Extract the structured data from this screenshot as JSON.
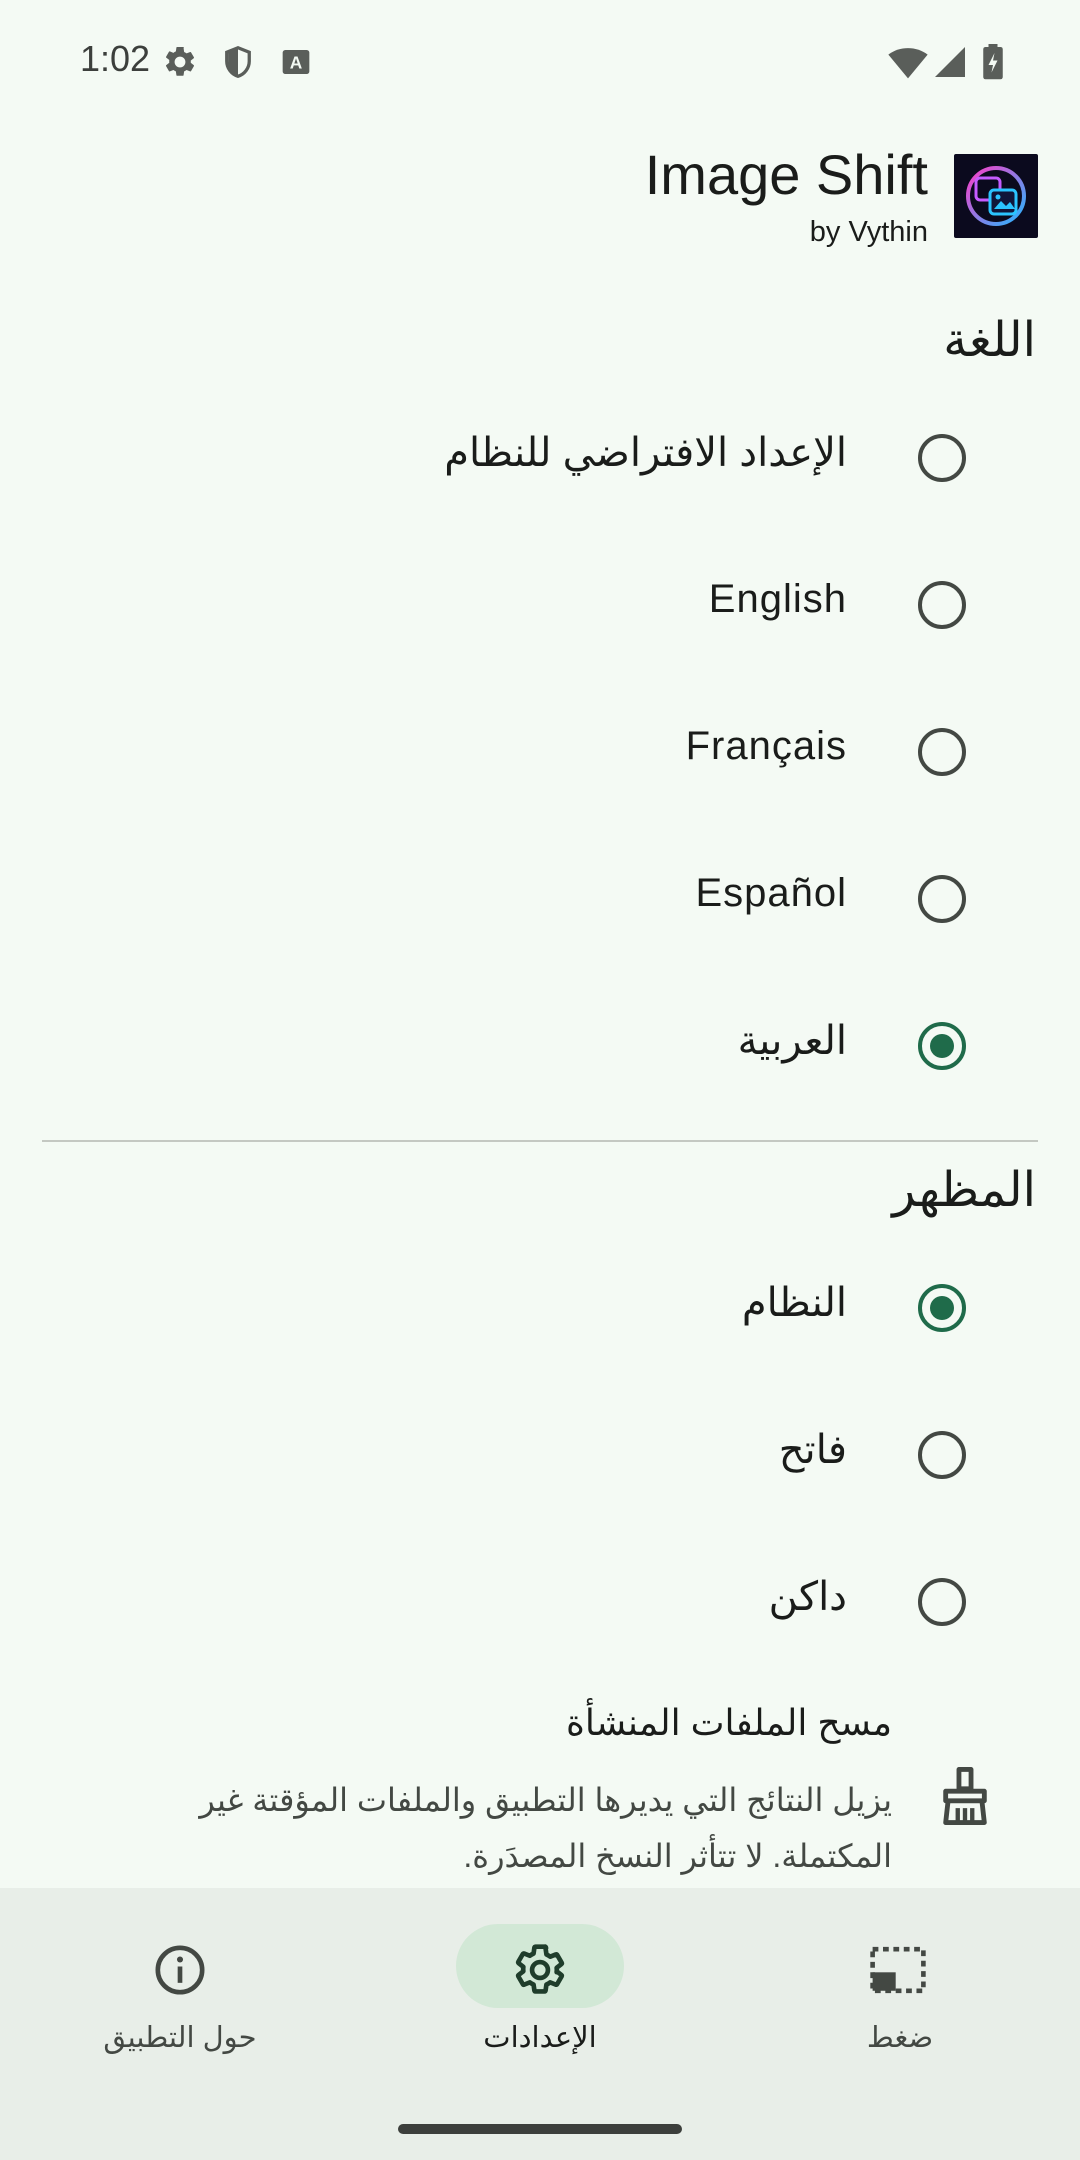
{
  "status_bar": {
    "time": "1:02",
    "icons": [
      "settings-icon",
      "shield-icon",
      "keyboard-a-icon",
      "wifi-icon",
      "signal-icon",
      "battery-charging-icon"
    ]
  },
  "header": {
    "title": "Image Shift",
    "subtitle": "by Vythin",
    "logo_icon": "image-shift-logo-icon"
  },
  "language": {
    "title": "اللغة",
    "options": [
      {
        "label": "الإعداد الافتراضي للنظام",
        "selected": false
      },
      {
        "label": "English",
        "selected": false
      },
      {
        "label": "Français",
        "selected": false
      },
      {
        "label": "Español",
        "selected": false
      },
      {
        "label": "العربية",
        "selected": true
      }
    ]
  },
  "appearance": {
    "title": "المظهر",
    "options": [
      {
        "label": "النظام",
        "selected": true
      },
      {
        "label": "فاتح",
        "selected": false
      },
      {
        "label": "داكن",
        "selected": false
      }
    ]
  },
  "clear_files": {
    "title": "مسح الملفات المنشأة",
    "description": "يزيل النتائج التي يديرها التطبيق والملفات المؤقتة غير المكتملة. لا تتأثر النسخ المصدَرة.",
    "icon": "broom-icon"
  },
  "bottom_nav": {
    "items": [
      {
        "label": "حول التطبيق",
        "icon": "info-icon",
        "active": false
      },
      {
        "label": "الإعدادات",
        "icon": "settings-icon",
        "active": true
      },
      {
        "label": "ضغط",
        "icon": "compress-icon",
        "active": false
      }
    ]
  },
  "colors": {
    "background": "#f4faf4",
    "accent": "#1f6b4a",
    "nav_background": "#e8eee8",
    "nav_active_pill": "#d2e8d6"
  }
}
